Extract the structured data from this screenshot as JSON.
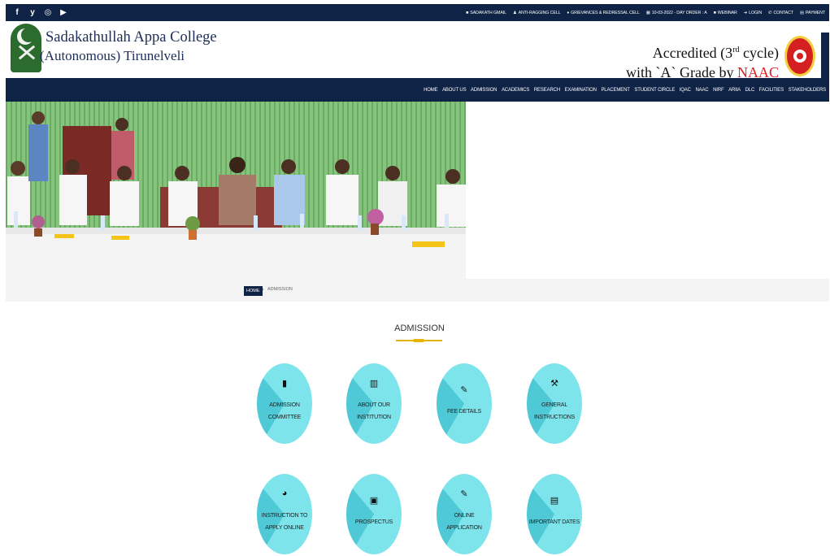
{
  "topbar": {
    "social_icons": [
      "facebook-icon",
      "twitter-icon",
      "instagram-icon",
      "youtube-icon"
    ],
    "social_glyphs": [
      "f",
      "y",
      "◎",
      "▶"
    ],
    "links": [
      {
        "icon": "■",
        "label": "SADAKATH GMAIL"
      },
      {
        "icon": "♟",
        "label": "ANTI-RAGGING CELL"
      },
      {
        "icon": "♦",
        "label": "GRIEVANCES & REDRESSAL CELL"
      },
      {
        "icon": "▦",
        "label": "10-03-2022 - DAY ORDER : A"
      },
      {
        "icon": "■",
        "label": "WEBINAR"
      },
      {
        "icon": "➜",
        "label": "LOGIN"
      },
      {
        "icon": "✆",
        "label": "CONTACT"
      },
      {
        "icon": "▤",
        "label": "PAYMENT"
      }
    ]
  },
  "header": {
    "college_name": "Sadakathullah Appa College",
    "college_sub": "(Autonomous) Tirunelveli",
    "accred_line1_a": "Accredited (3",
    "accred_line1_sup": "rd",
    "accred_line1_b": " cycle)",
    "accred_line2_a": "with `A` Grade by ",
    "accred_line2_naac": "NAAC"
  },
  "nav": [
    "HOME",
    "ABOUT US",
    "ADMISSION",
    "ACADEMICS",
    "RESEARCH",
    "EXAMINATION",
    "PLACEMENT",
    "STUDENT CIRCLE",
    "IQAC",
    "NAAC",
    "NIRF",
    "ARIIA",
    "DLC",
    "FACILITIES",
    "STAKEHOLDERS"
  ],
  "breadcrumb": {
    "home": "HOME",
    "separator": "›",
    "current": "ADMISSION"
  },
  "section_title": "ADMISSION",
  "tiles": [
    {
      "icon": "book-icon",
      "glyph": "▮",
      "line1": "ADMISSION",
      "line2": "COMMITTEE"
    },
    {
      "icon": "institution-icon",
      "glyph": "▥",
      "line1": "ABOUT OUR",
      "line2": "INSTITUTION"
    },
    {
      "icon": "edit-icon",
      "glyph": "✎",
      "line1": "FEE DETAILS",
      "line2": ""
    },
    {
      "icon": "gavel-icon",
      "glyph": "⚒",
      "line1": "GENERAL",
      "line2": "INSTRUCTIONS"
    },
    {
      "icon": "globe-icon",
      "glyph": "◕",
      "line1": "INSTRUCTION TO",
      "line2": "APPLY ONLINE"
    },
    {
      "icon": "image-icon",
      "glyph": "▣",
      "line1": "PROSPECTUS",
      "line2": ""
    },
    {
      "icon": "edit-icon",
      "glyph": "✎",
      "line1": "ONLINE",
      "line2": "APPLICATION"
    },
    {
      "icon": "calendar-icon",
      "glyph": "▤",
      "line1": "IMPORTANT DATES",
      "line2": ""
    }
  ]
}
